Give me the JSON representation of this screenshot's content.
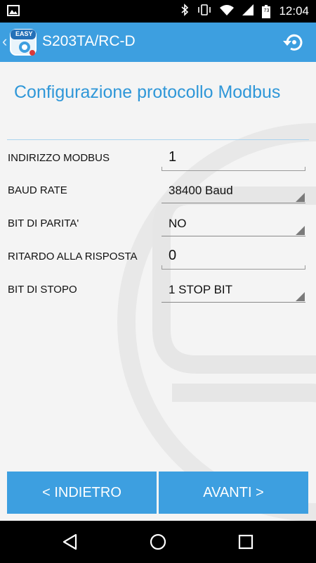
{
  "status_bar": {
    "time": "12:04",
    "icons": [
      "image-icon",
      "bluetooth-icon",
      "vibrate-icon",
      "wifi-icon",
      "signal-icon",
      "battery-icon"
    ],
    "battery_text": "73"
  },
  "app_bar": {
    "logo_text": "EASY",
    "title": "S203TA/RC-D",
    "restart_icon": "restart-icon"
  },
  "page": {
    "title": "Configurazione protocollo Modbus"
  },
  "form": {
    "rows": [
      {
        "label": "INDIRIZZO MODBUS",
        "value": "1",
        "type": "input"
      },
      {
        "label": "BAUD RATE",
        "value": "38400 Baud",
        "type": "select"
      },
      {
        "label": "BIT DI PARITA'",
        "value": "NO",
        "type": "select"
      },
      {
        "label": "RITARDO ALLA RISPOSTA",
        "value": "0",
        "type": "input"
      },
      {
        "label": "BIT DI STOPO",
        "value": "1 STOP BIT",
        "type": "select"
      }
    ]
  },
  "buttons": {
    "back": "< INDIETRO",
    "next": "AVANTI >"
  },
  "colors": {
    "accent": "#3d9fe0",
    "title": "#2f97d8",
    "background": "#f4f4f4"
  }
}
